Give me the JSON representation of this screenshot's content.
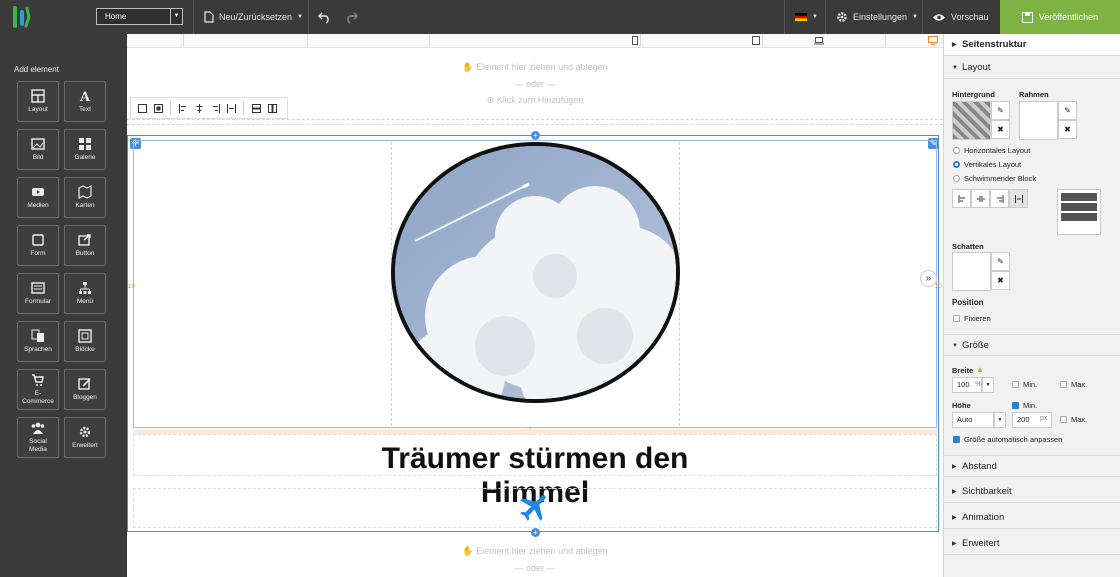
{
  "topbar": {
    "page_select": "Home",
    "new_reset": "Neu/Zurücksetzen",
    "settings": "Einstellungen",
    "preview": "Vorschau",
    "publish": "Veröffentlichen",
    "accent": "#7cb342"
  },
  "leftbar": {
    "title": "Add element",
    "items": [
      {
        "label": "Layout",
        "icon": "layout-icon"
      },
      {
        "label": "Text",
        "icon": "text-icon"
      },
      {
        "label": "Bild",
        "icon": "image-icon"
      },
      {
        "label": "Galerie",
        "icon": "gallery-icon"
      },
      {
        "label": "Medien",
        "icon": "media-icon"
      },
      {
        "label": "Karten",
        "icon": "map-icon"
      },
      {
        "label": "Form",
        "icon": "form-icon"
      },
      {
        "label": "Button",
        "icon": "button-icon"
      },
      {
        "label": "Formular",
        "icon": "formular-icon"
      },
      {
        "label": "Menü",
        "icon": "menu-icon"
      },
      {
        "label": "Sprachen",
        "icon": "languages-icon"
      },
      {
        "label": "Blöcke",
        "icon": "blocks-icon"
      },
      {
        "label": "E-\nCommerce",
        "icon": "cart-icon"
      },
      {
        "label": "Bloggen",
        "icon": "blog-icon"
      },
      {
        "label": "Social\nMedia",
        "icon": "social-icon"
      },
      {
        "label": "Erweitert",
        "icon": "advanced-icon"
      }
    ]
  },
  "canvas": {
    "drop_hint": "Element hier ziehen und ablegen",
    "or": "— oder —",
    "click_add": "Klick zum Hinzufügen",
    "heading": "Träumer stürmen den Himmel",
    "spacing_label": "10px",
    "spacing_label_side": "10"
  },
  "rightbar": {
    "structure": "Seitenstruktur",
    "layout": "Layout",
    "background": "Hintergrund",
    "border": "Rahmen",
    "opt_horizontal": "Horizontales Layout",
    "opt_vertical": "Vertikales Layout",
    "opt_floating": "Schwimmender Block",
    "shadow": "Schatten",
    "position": "Position",
    "fix": "Fixieren",
    "size": "Größe",
    "width": "Breite",
    "width_value": "100",
    "width_unit": "%",
    "min": "Min.",
    "max": "Max.",
    "height": "Höhe",
    "height_value": "Auto",
    "height_min_value": "200",
    "height_min_unit": "px",
    "auto_size": "Größe automatisch anpassen",
    "spacing": "Abstand",
    "visibility": "Sichtbarkeit",
    "animation": "Animation",
    "advanced": "Erweitert"
  }
}
